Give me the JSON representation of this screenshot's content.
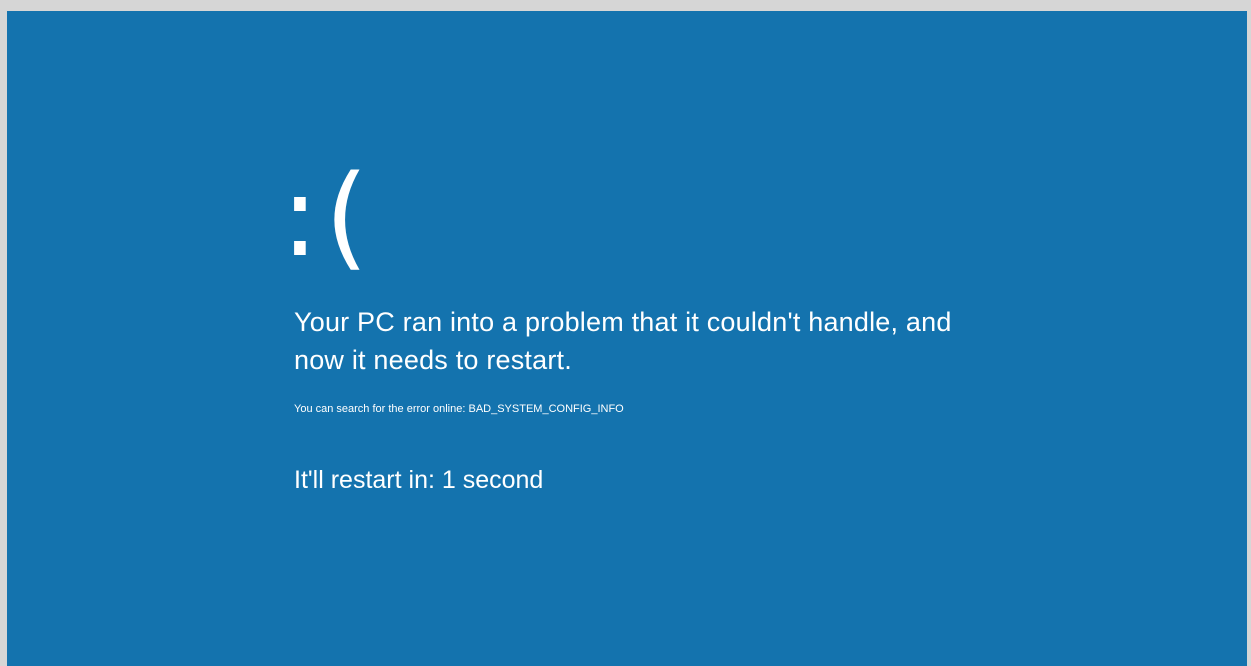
{
  "screen": {
    "background_color": "#1473ae",
    "frame_color": "#d6d6d6",
    "text_color": "#ffffff"
  },
  "bsod": {
    "face": ":(",
    "message": "Your PC ran into a problem that it couldn't handle, and now it needs to restart.",
    "hint_prefix": "You can search for the error online: ",
    "error_code": "BAD_SYSTEM_CONFIG_INFO",
    "countdown": "It'll restart in: 1 second"
  }
}
